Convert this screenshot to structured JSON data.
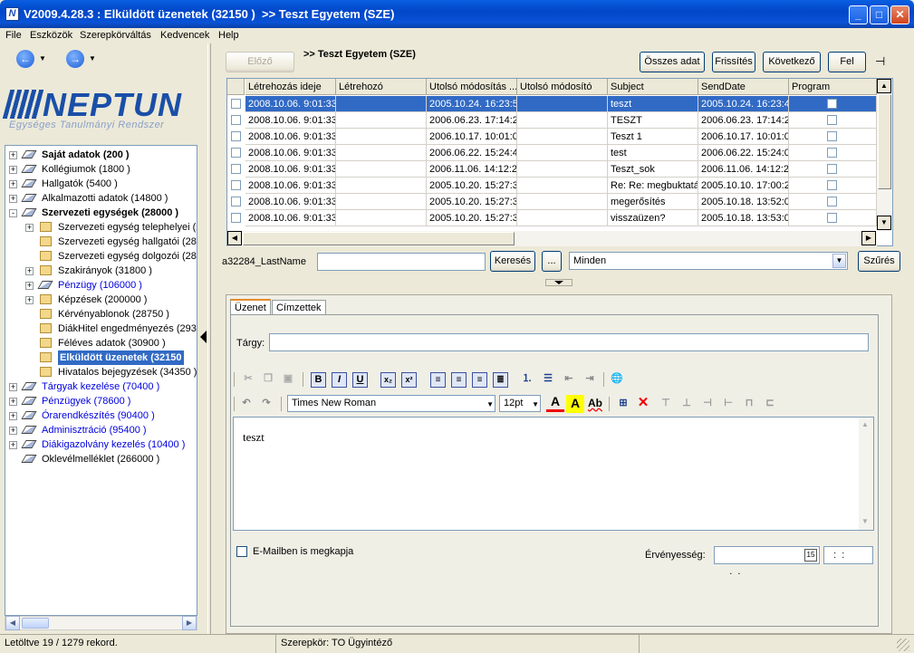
{
  "window": {
    "title": "V2009.4.28.3 : Elküldött üzenetek (32150 )  >> Teszt Egyetem (SZE)"
  },
  "menu": [
    "File",
    "Eszközök",
    "Szerepkörváltás",
    "Kedvencek",
    "Help"
  ],
  "logo": {
    "name": "NEPTUN",
    "tagline": "Egységes Tanulmányi Rendszer"
  },
  "tree": [
    {
      "label": "Saját adatok (200  )",
      "level": 0,
      "exp": "+",
      "style": "bold",
      "icon": "book"
    },
    {
      "label": "Kollégiumok (1800  )",
      "level": 0,
      "exp": "+",
      "style": "",
      "icon": "book"
    },
    {
      "label": "Hallgatók (5400  )",
      "level": 0,
      "exp": "+",
      "style": "",
      "icon": "book"
    },
    {
      "label": "Alkalmazotti adatok (14800  )",
      "level": 0,
      "exp": "+",
      "style": "",
      "icon": "book"
    },
    {
      "label": "Szervezeti egységek (28000  )",
      "level": 0,
      "exp": "-",
      "style": "bold",
      "icon": "book"
    },
    {
      "label": "Szervezeti egység telephelyei (2",
      "level": 1,
      "exp": "+",
      "style": "",
      "icon": "folder"
    },
    {
      "label": "Szervezeti egység hallgatói (286",
      "level": 1,
      "exp": "",
      "style": "",
      "icon": "folder"
    },
    {
      "label": "Szervezeti egység dolgozói (288",
      "level": 1,
      "exp": "",
      "style": "",
      "icon": "folder"
    },
    {
      "label": "Szakirányok (31800  )",
      "level": 1,
      "exp": "+",
      "style": "",
      "icon": "folder"
    },
    {
      "label": "Pénzügy (106000  )",
      "level": 1,
      "exp": "+",
      "style": "blue",
      "icon": "book"
    },
    {
      "label": "Képzések (200000  )",
      "level": 1,
      "exp": "+",
      "style": "",
      "icon": "folder"
    },
    {
      "label": "Kérvényablonok (28750  )",
      "level": 1,
      "exp": "",
      "style": "",
      "icon": "folder"
    },
    {
      "label": "DiákHitel engedményezés (2935",
      "level": 1,
      "exp": "",
      "style": "",
      "icon": "folder"
    },
    {
      "label": "Féléves adatok (30900  )",
      "level": 1,
      "exp": "",
      "style": "",
      "icon": "folder"
    },
    {
      "label": "Elküldött üzenetek (32150",
      "level": 1,
      "exp": "",
      "style": "sel",
      "icon": "folder"
    },
    {
      "label": "Hivatalos bejegyzések (34350  )",
      "level": 1,
      "exp": "",
      "style": "",
      "icon": "folder"
    },
    {
      "label": "Tárgyak kezelése (70400  )",
      "level": 0,
      "exp": "+",
      "style": "blue",
      "icon": "book"
    },
    {
      "label": "Pénzügyek (78600  )",
      "level": 0,
      "exp": "+",
      "style": "blue",
      "icon": "book"
    },
    {
      "label": "Órarendkészítés (90400  )",
      "level": 0,
      "exp": "+",
      "style": "blue",
      "icon": "book"
    },
    {
      "label": "Adminisztráció (95400  )",
      "level": 0,
      "exp": "+",
      "style": "blue",
      "icon": "book"
    },
    {
      "label": "Diákigazolvány kezelés (10400  )",
      "level": 0,
      "exp": "+",
      "style": "blue",
      "icon": "book"
    },
    {
      "label": "Oklevélmelléklet (266000  )",
      "level": 0,
      "exp": "",
      "style": "",
      "icon": "book"
    }
  ],
  "toolbar": {
    "prev": "Előző",
    "breadcrumb": ">> Teszt Egyetem (SZE)",
    "all": "Összes adat",
    "refresh": "Frissítés",
    "next": "Következő",
    "up": "Fel"
  },
  "grid": {
    "columns": [
      "Létrehozás ideje",
      "Létrehozó",
      "Utolsó módosítás ...",
      "Utolsó módosító",
      "Subject",
      "SendDate",
      "Program"
    ],
    "rows": [
      [
        "2008.10.06. 9:01:33",
        "",
        "2005.10.24. 16:23:5",
        "",
        "teszt",
        "2005.10.24. 16:23:4"
      ],
      [
        "2008.10.06. 9:01:33",
        "",
        "2006.06.23. 17:14:2",
        "",
        "TESZT",
        "2006.06.23. 17:14:2"
      ],
      [
        "2008.10.06. 9:01:33",
        "",
        "2006.10.17. 10:01:0",
        "",
        "Teszt 1",
        "2006.10.17. 10:01:0"
      ],
      [
        "2008.10.06. 9:01:33",
        "",
        "2006.06.22. 15:24:4",
        "",
        "test",
        "2006.06.22. 15:24:0"
      ],
      [
        "2008.10.06. 9:01:33",
        "",
        "2006.11.06. 14:12:2",
        "",
        "Teszt_sok",
        "2006.11.06. 14:12:2"
      ],
      [
        "2008.10.06. 9:01:33",
        "",
        "2005.10.20. 15:27:3",
        "",
        "Re: Re: megbuktatá",
        "2005.10.10. 17:00:2"
      ],
      [
        "2008.10.06. 9:01:33",
        "",
        "2005.10.20. 15:27:3",
        "",
        "megerősítés",
        "2005.10.18. 13:52:0"
      ],
      [
        "2008.10.06. 9:01:33",
        "",
        "2005.10.20. 15:27:3",
        "",
        "visszaüzen?",
        "2005.10.18. 13:53:0"
      ]
    ]
  },
  "search": {
    "field_label": "a32284_LastName",
    "value": "",
    "search_btn": "Keresés",
    "dots": "...",
    "filter": "Minden",
    "filter_btn": "Szűrés"
  },
  "tabs": [
    "Üzenet",
    "Címzettek"
  ],
  "message": {
    "subject_label": "Tárgy:",
    "subject": "",
    "font": "Times New Roman",
    "size": "12pt",
    "body": "teszt",
    "email_label": "E-Mailben is megkapja",
    "validity_label": "Érvényesség:",
    "date": "  .  .",
    "time": "  :  :"
  },
  "status": {
    "records": "Letöltve 19 / 1279 rekord.",
    "role": "Szerepkör: TO Ügyintéző"
  }
}
